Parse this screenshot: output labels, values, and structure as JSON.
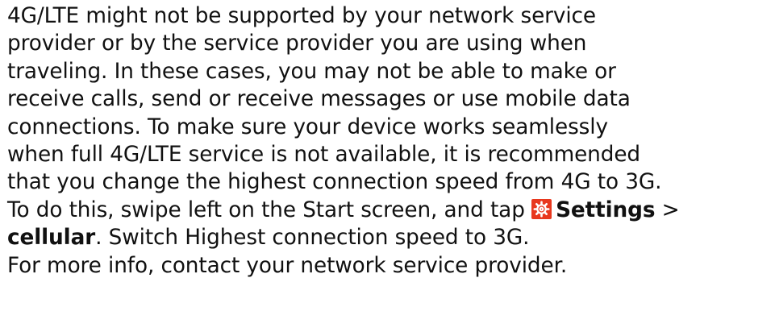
{
  "paragraph": {
    "line1": "4G/LTE might not be supported by your network service",
    "line2": "provider or by the service provider you are using when",
    "line3": "traveling. In these cases, you may not be able to make or",
    "line4": "receive calls, send or receive messages or use mobile data",
    "line5": "connections. To make sure your device works seamlessly",
    "line6": "when full 4G/LTE service is not available, it is recommended",
    "line7": "that you change the highest connection speed from 4G to 3G.",
    "line8_prefix": "To do this, swipe left on the Start screen, and tap ",
    "settings_label": "Settings",
    "separator": " >",
    "cellular_label": "cellular",
    "line9_suffix": ". Switch Highest connection speed to 3G.",
    "line10": "For more info, contact your network service provider."
  },
  "icons": {
    "settings": "gear-icon",
    "settings_icon_color": "#e8381e"
  }
}
